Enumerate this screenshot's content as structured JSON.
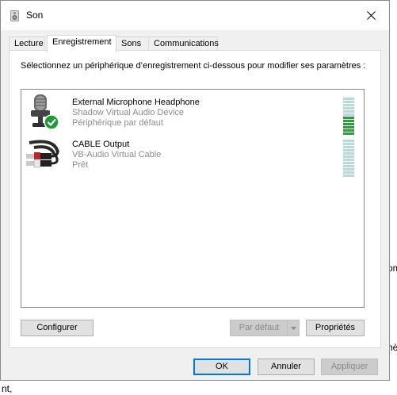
{
  "window": {
    "title": "Son",
    "close_glyph": "✕"
  },
  "tabs": [
    {
      "label": "Lecture"
    },
    {
      "label": "Enregistrement"
    },
    {
      "label": "Sons"
    },
    {
      "label": "Communications"
    }
  ],
  "active_tab": "Enregistrement",
  "instruction": "Sélectionnez un périphérique d’enregistrement ci-dessous pour modifier ses paramètres :",
  "devices": [
    {
      "name": "External Microphone Headphone",
      "driver": "Shadow Virtual Audio Device",
      "status": "Périphérique par défaut",
      "icon": "microphone-icon",
      "badge": "default-check-icon",
      "level_segments_total": 12,
      "level_segments_on": 6
    },
    {
      "name": "CABLE Output",
      "driver": "VB-Audio Virtual Cable",
      "status": "Prêt",
      "icon": "rca-cable-icon",
      "level_segments_total": 12,
      "level_segments_on": 0
    }
  ],
  "buttons": {
    "configure": "Configurer",
    "set_default": "Par défaut",
    "properties": "Propriétés",
    "ok": "OK",
    "cancel": "Annuler",
    "apply": "Appliquer"
  },
  "colors": {
    "accent": "#0078d7",
    "check_green": "#1f9a3a",
    "meter_on": "#2f9e3d",
    "meter_off": "#b8dadb"
  },
  "background_fragments": {
    "a": "a",
    "om": "om",
    "ne": "nè",
    "nt": "nt,"
  }
}
